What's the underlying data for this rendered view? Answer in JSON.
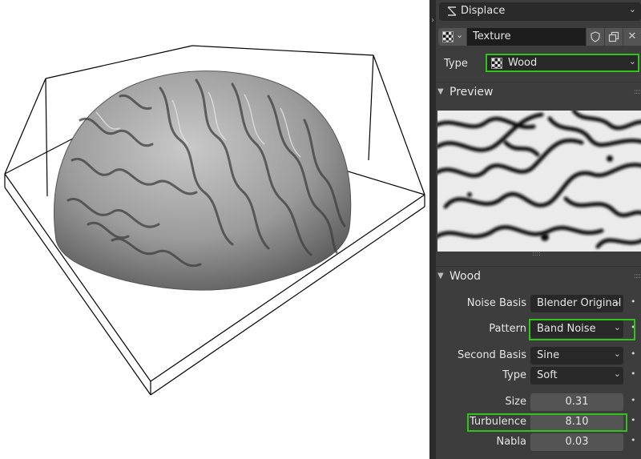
{
  "modifier": {
    "name": "Displace"
  },
  "texture": {
    "name": "Texture"
  },
  "type_row": {
    "label": "Type",
    "value": "Wood"
  },
  "preview_panel": {
    "title": "Preview"
  },
  "wood_panel": {
    "title": "Wood",
    "rows": [
      {
        "label": "Noise Basis",
        "value": "Blender Original"
      },
      {
        "label": "Pattern",
        "value": "Band Noise"
      },
      {
        "label": "Second Basis",
        "value": "Sine"
      },
      {
        "label": "Type",
        "value": "Soft"
      },
      {
        "label": "Size",
        "value": "0.31"
      },
      {
        "label": "Turbulence",
        "value": "8.10"
      },
      {
        "label": "Nabla",
        "value": "0.03"
      }
    ]
  },
  "colors": {
    "highlight": "#2ec41a",
    "panel_bg": "#3d3d3d",
    "field_dark": "#282828",
    "field_num": "#545454"
  },
  "icons": [
    "wrench-icon",
    "checker-texture-icon",
    "shield-icon",
    "copy-icon",
    "close-icon",
    "chevron-down-icon"
  ]
}
